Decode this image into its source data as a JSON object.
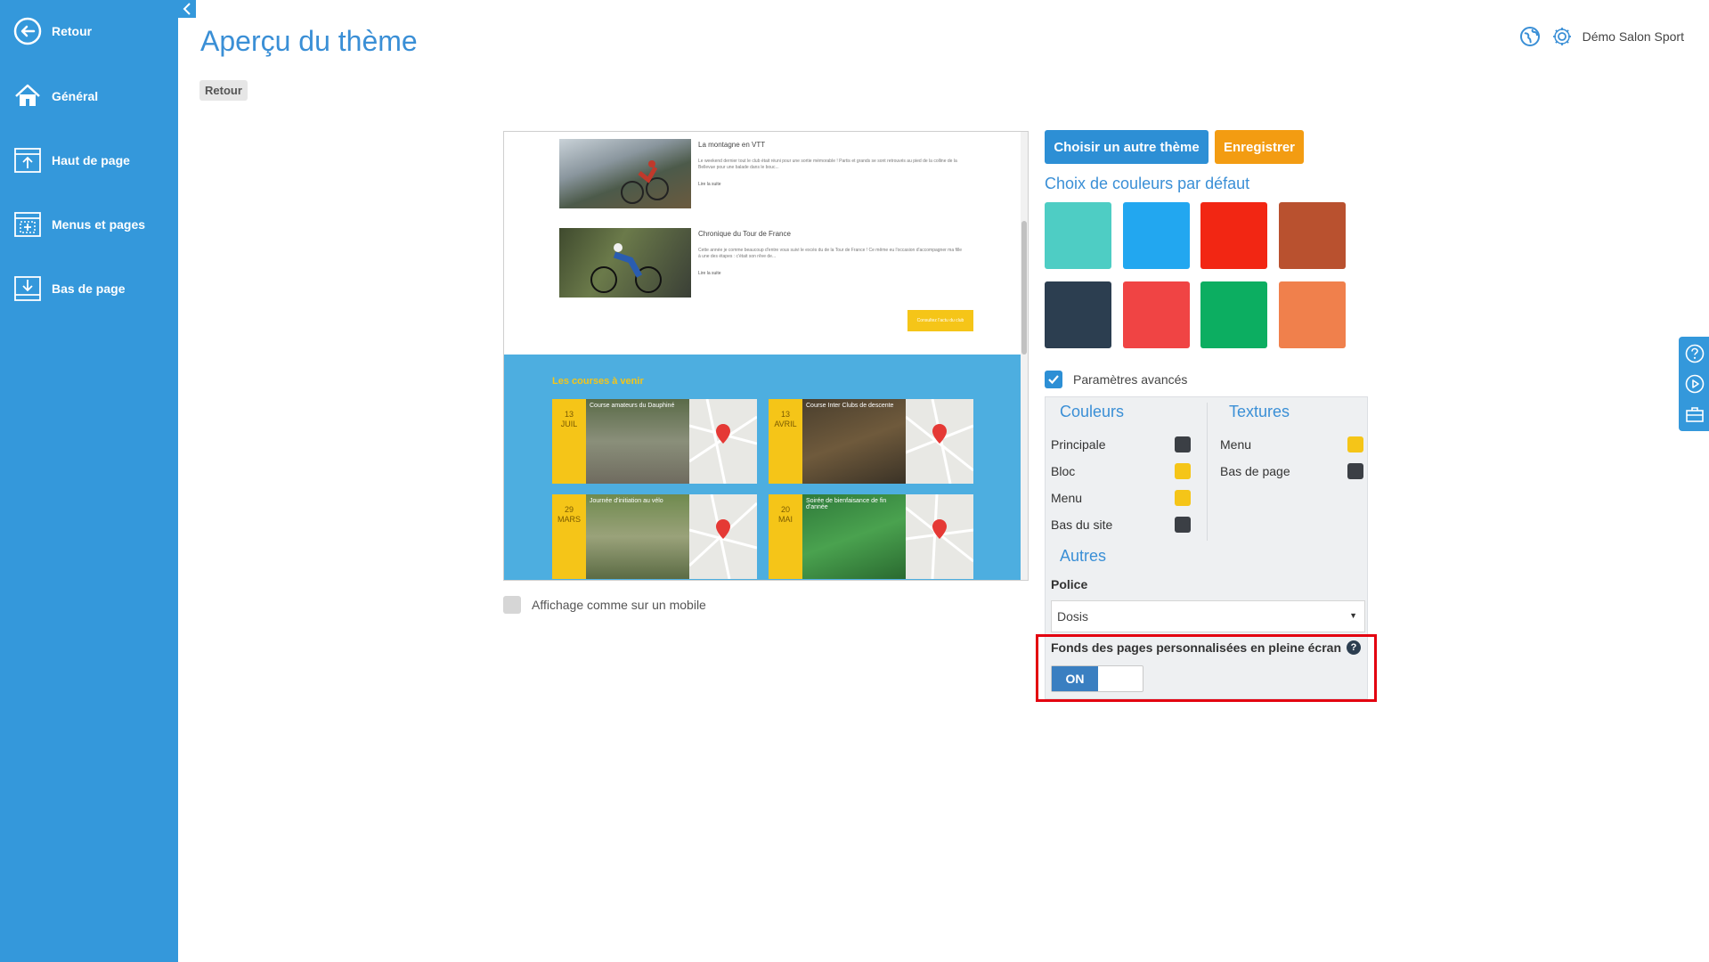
{
  "sidebar": {
    "items": [
      {
        "label": "Retour",
        "icon": "back-circle-icon"
      },
      {
        "label": "Général",
        "icon": "home-icon"
      },
      {
        "label": "Haut de page",
        "icon": "page-top-icon"
      },
      {
        "label": "Menus et pages",
        "icon": "menu-pages-icon"
      },
      {
        "label": "Bas de page",
        "icon": "page-bottom-icon"
      }
    ]
  },
  "header": {
    "title": "Aperçu du thème",
    "back_label": "Retour",
    "site_name": "Démo Salon Sport"
  },
  "preview": {
    "articles": [
      {
        "title": "La montagne en VTT",
        "text": "Le weekend dernier tout le club était réuni pour une sortie mémorable ! Partis et grands se sont retrouvés au pied de la colline de la Bellevue pour une balade dans le bouc...",
        "more": "Lire la suite"
      },
      {
        "title": "Chronique du Tour de France",
        "text": "Cette année je comme beaucoup d'entre vous suivi le excès du de la Tour de France ! Ce même eu l'occasion d'accompagner ma fille à une des étapes : c'était son rêve de...",
        "more": "Lire la suite"
      }
    ],
    "club_button": "Consultez l'actu du club",
    "events_title": "Les courses à venir",
    "events": [
      {
        "day": "13",
        "month": "JUIL",
        "title": "Course amateurs du Dauphiné"
      },
      {
        "day": "13",
        "month": "AVRIL",
        "title": "Course Inter Clubs de descente"
      },
      {
        "day": "29",
        "month": "MARS",
        "title": "Journée d'initiation au vélo"
      },
      {
        "day": "20",
        "month": "MAI",
        "title": "Soirée de bienfaisance de fin d'année"
      }
    ]
  },
  "mobile_label": "Affichage comme sur un mobile",
  "actions": {
    "choose_theme": "Choisir un autre thème",
    "save": "Enregistrer"
  },
  "default_colors_title": "Choix de couleurs par défaut",
  "swatches": [
    "#4ecdc4",
    "#22a7f0",
    "#f22613",
    "#b9512f",
    "#2c3e50",
    "#f04444",
    "#0cae61",
    "#f0804c"
  ],
  "advanced": {
    "label": "Paramètres avancés",
    "couleurs_title": "Couleurs",
    "textures_title": "Textures",
    "couleurs": [
      {
        "label": "Principale",
        "color": "#3b3f45"
      },
      {
        "label": "Bloc",
        "color": "#f5c518"
      },
      {
        "label": "Menu",
        "color": "#f5c518"
      },
      {
        "label": "Bas du site",
        "color": "#3b3f45"
      }
    ],
    "textures": [
      {
        "label": "Menu",
        "color": "#f5c518"
      },
      {
        "label": "Bas de page",
        "color": "#3b3f45"
      }
    ],
    "autres_title": "Autres",
    "police_label": "Police",
    "police_value": "Dosis",
    "fullscreen_label": "Fonds des pages personnalisées en pleine écran",
    "toggle_on": "ON"
  }
}
